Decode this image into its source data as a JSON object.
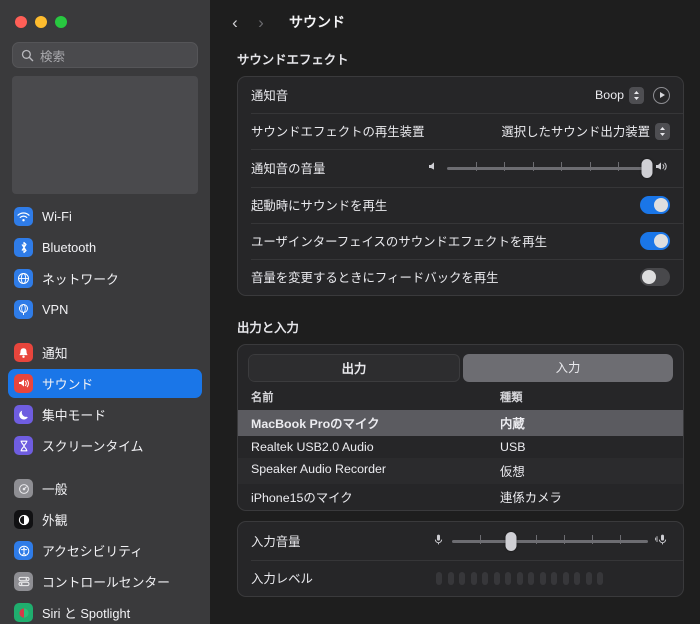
{
  "window": {
    "traffic_lights": [
      "close",
      "minimize",
      "zoom"
    ],
    "colors": {
      "close": "#ff5f57",
      "minimize": "#febc2e",
      "zoom": "#28c840",
      "accent": "#1a76e8"
    }
  },
  "sidebar": {
    "search": {
      "placeholder": "検索",
      "value": ""
    },
    "groups": [
      {
        "items": [
          {
            "label": "Wi-Fi",
            "icon": "wifi-icon",
            "color": "#2f7ce8",
            "glyph": "≋",
            "selected": false
          },
          {
            "label": "Bluetooth",
            "icon": "bluetooth-icon",
            "color": "#2f7ce8",
            "glyph": "ᛒ",
            "selected": false
          },
          {
            "label": "ネットワーク",
            "icon": "network-icon",
            "color": "#2f7ce8",
            "glyph": "◍",
            "selected": false
          },
          {
            "label": "VPN",
            "icon": "vpn-icon",
            "color": "#2f7ce8",
            "glyph": "◍",
            "selected": false
          }
        ]
      },
      {
        "items": [
          {
            "label": "通知",
            "icon": "notifications-icon",
            "color": "#e8453c",
            "glyph": "△",
            "selected": false
          },
          {
            "label": "サウンド",
            "icon": "sound-icon",
            "color": "#e8453c",
            "glyph": "◂",
            "selected": true
          },
          {
            "label": "集中モード",
            "icon": "focus-icon",
            "color": "#6f5de0",
            "glyph": "☽",
            "selected": false
          },
          {
            "label": "スクリーンタイム",
            "icon": "screen-time-icon",
            "color": "#6f5de0",
            "glyph": "⧗",
            "selected": false
          }
        ]
      },
      {
        "items": [
          {
            "label": "一般",
            "icon": "general-icon",
            "color": "#8e8e93",
            "glyph": "⚙",
            "selected": false
          },
          {
            "label": "外観",
            "icon": "appearance-icon",
            "color": "#111113",
            "glyph": "◑",
            "selected": false
          },
          {
            "label": "アクセシビリティ",
            "icon": "accessibility-icon",
            "color": "#2f7ce8",
            "glyph": "Ⓙ",
            "selected": false
          },
          {
            "label": "コントロールセンター",
            "icon": "control-center-icon",
            "color": "#8e8e93",
            "glyph": "⌸",
            "selected": false
          },
          {
            "label": "Siri と Spotlight",
            "icon": "siri-icon",
            "color": "#1fae6e",
            "glyph": "◉",
            "selected": false
          }
        ]
      }
    ]
  },
  "header": {
    "back_label": "‹",
    "forward_label": "›",
    "title": "サウンド"
  },
  "sound_effects": {
    "section_title": "サウンドエフェクト",
    "alert_sound": {
      "label": "通知音",
      "value": "Boop",
      "play_label": "▶"
    },
    "play_device": {
      "label": "サウンドエフェクトの再生装置",
      "value": "選択したサウンド出力装置"
    },
    "alert_volume": {
      "label": "通知音の音量",
      "value": 100,
      "ticks": 6
    },
    "toggles": [
      {
        "label": "起動時にサウンドを再生",
        "on": true
      },
      {
        "label": "ユーザインターフェイスのサウンドエフェクトを再生",
        "on": true
      },
      {
        "label": "音量を変更するときにフィードバックを再生",
        "on": false
      }
    ]
  },
  "output_input": {
    "section_title": "出力と入力",
    "tabs": [
      {
        "label": "出力",
        "active": false
      },
      {
        "label": "入力",
        "active": true
      }
    ],
    "table": {
      "columns": [
        "名前",
        "種類"
      ],
      "rows": [
        {
          "name": "MacBook Proのマイク",
          "kind": "内蔵",
          "selected": true
        },
        {
          "name": "Realtek USB2.0 Audio",
          "kind": "USB",
          "selected": false
        },
        {
          "name": "Speaker Audio Recorder",
          "kind": "仮想",
          "selected": false
        },
        {
          "name": "iPhone15のマイク",
          "kind": "連係カメラ",
          "selected": false
        }
      ]
    },
    "input_volume": {
      "label": "入力音量",
      "value": 30,
      "ticks": 6
    },
    "input_level": {
      "label": "入力レベル",
      "segments": 15,
      "active": 0
    }
  }
}
